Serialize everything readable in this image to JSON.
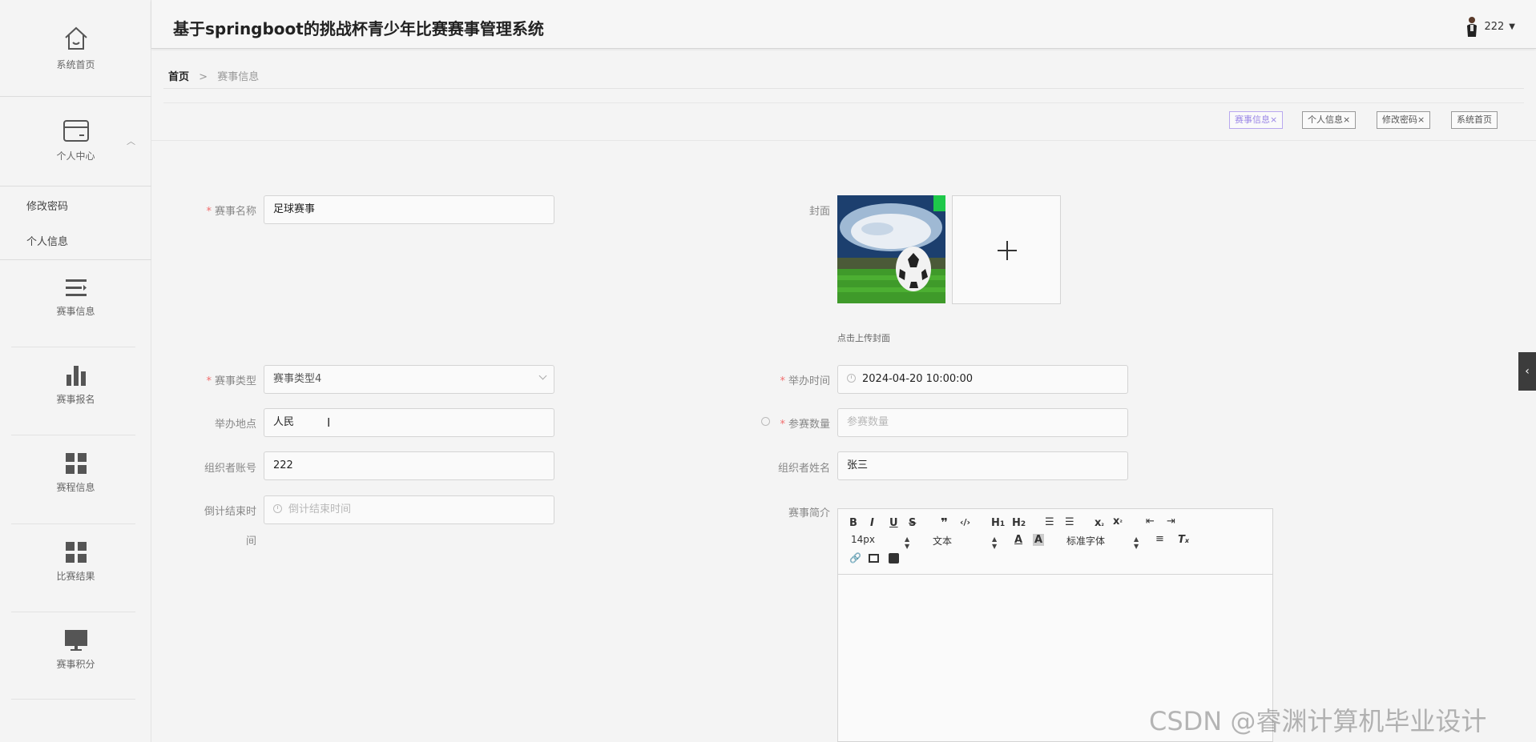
{
  "header": {
    "title": "基于springboot的挑战杯青少年比赛赛事管理系统",
    "username": "222"
  },
  "sidebar": {
    "home_label": "系统首页",
    "personal_center_label": "个人中心",
    "sub_items": [
      "修改密码",
      "个人信息"
    ],
    "items": [
      {
        "label": "赛事信息",
        "icon": "menu-lines-icon"
      },
      {
        "label": "赛事报名",
        "icon": "bar-chart-icon"
      },
      {
        "label": "赛程信息",
        "icon": "grid-icon"
      },
      {
        "label": "比赛结果",
        "icon": "grid-icon"
      },
      {
        "label": "赛事积分",
        "icon": "monitor-icon"
      }
    ]
  },
  "breadcrumb": {
    "home": "首页",
    "separator": ">",
    "current": "赛事信息"
  },
  "tags": [
    {
      "label": "赛事信息",
      "close": "×",
      "active": true
    },
    {
      "label": "个人信息",
      "close": "×",
      "active": false
    },
    {
      "label": "修改密码",
      "close": "×",
      "active": false
    },
    {
      "label": "系统首页",
      "close": "",
      "active": false
    }
  ],
  "form": {
    "required_mark": "*",
    "event_name": {
      "label": "赛事名称",
      "value": "足球赛事"
    },
    "cover": {
      "label": "封面",
      "hint": "点击上传封面"
    },
    "event_type": {
      "label": "赛事类型",
      "value": "赛事类型4"
    },
    "hold_time": {
      "label": "举办时间",
      "value": "2024-04-20 10:00:00"
    },
    "hold_place": {
      "label": "举办地点",
      "value": "人民"
    },
    "participants": {
      "label": "参赛数量",
      "placeholder": "参赛数量"
    },
    "organizer_account": {
      "label": "组织者账号",
      "value": "222"
    },
    "organizer_name": {
      "label": "组织者姓名",
      "value": "张三"
    },
    "countdown_end": {
      "label_line1": "倒计结束时",
      "label_line2": "间",
      "placeholder": "倒计结束时间"
    },
    "intro": {
      "label": "赛事简介"
    }
  },
  "editor_toolbar": {
    "font_size": "14px",
    "header_select": "文本",
    "font_family": "标准字体"
  },
  "watermark": "CSDN @睿渊计算机毕业设计"
}
